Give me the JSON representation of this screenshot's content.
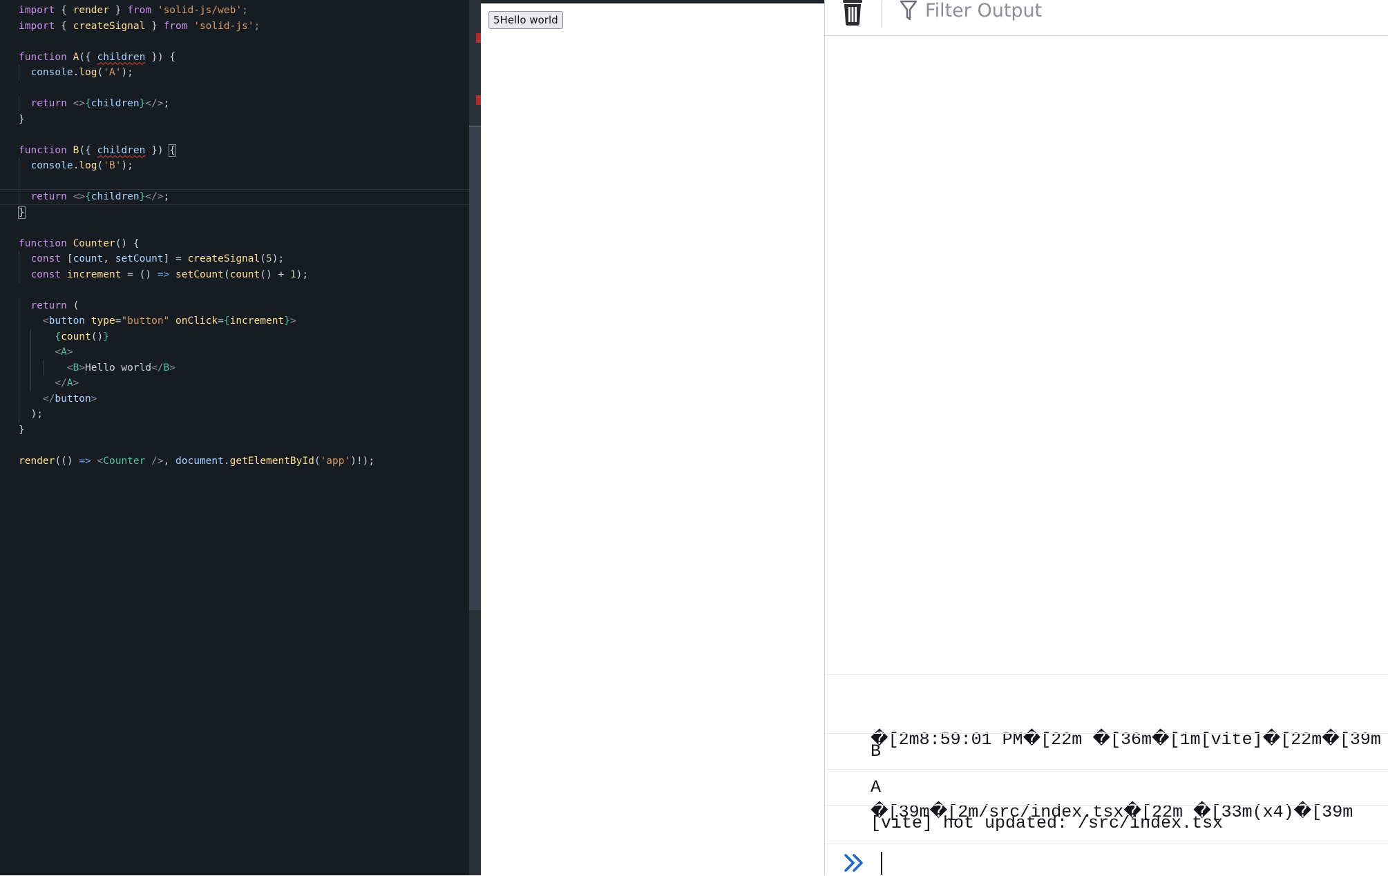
{
  "editor": {
    "lines": [
      [
        [
          "kw",
          "import"
        ],
        [
          "pl",
          " { "
        ],
        [
          "fn",
          "render"
        ],
        [
          "pl",
          " } "
        ],
        [
          "kw",
          "from"
        ],
        [
          "pl",
          " "
        ],
        [
          "st",
          "'solid-js/web'"
        ],
        [
          "pu",
          ";"
        ]
      ],
      [
        [
          "kw",
          "import"
        ],
        [
          "pl",
          " { "
        ],
        [
          "fn",
          "createSignal"
        ],
        [
          "pl",
          " } "
        ],
        [
          "kw",
          "from"
        ],
        [
          "pl",
          " "
        ],
        [
          "st",
          "'solid-js'"
        ],
        [
          "pu",
          ";"
        ]
      ],
      [],
      [
        [
          "kw",
          "function"
        ],
        [
          "pl",
          " "
        ],
        [
          "fn",
          "A"
        ],
        [
          "pl",
          "({ "
        ],
        [
          "vsq",
          "children"
        ],
        [
          "pl",
          " }) {"
        ]
      ],
      [
        [
          "pl",
          "  "
        ],
        [
          "var",
          "console"
        ],
        [
          "pl",
          "."
        ],
        [
          "fn",
          "log"
        ],
        [
          "pl",
          "("
        ],
        [
          "st",
          "'A'"
        ],
        [
          "pl",
          ");"
        ]
      ],
      [],
      [
        [
          "pl",
          "  "
        ],
        [
          "kw",
          "return"
        ],
        [
          "pl",
          " "
        ],
        [
          "pu",
          "<>"
        ],
        [
          "tag",
          "{"
        ],
        [
          "var",
          "children"
        ],
        [
          "tag",
          "}"
        ],
        [
          "pu",
          "</>"
        ],
        [
          "pl",
          ";"
        ]
      ],
      [
        [
          "pl",
          "}"
        ]
      ],
      [],
      [
        [
          "kw",
          "function"
        ],
        [
          "pl",
          " "
        ],
        [
          "fn",
          "B"
        ],
        [
          "pl",
          "({ "
        ],
        [
          "vsq",
          "children"
        ],
        [
          "pl",
          " }) "
        ],
        [
          "box",
          "{"
        ]
      ],
      [
        [
          "pl",
          "  "
        ],
        [
          "var",
          "console"
        ],
        [
          "pl",
          "."
        ],
        [
          "fn",
          "log"
        ],
        [
          "pl",
          "("
        ],
        [
          "st",
          "'B'"
        ],
        [
          "pl",
          ");"
        ]
      ],
      [],
      [
        [
          "pl",
          "  "
        ],
        [
          "kw",
          "return"
        ],
        [
          "pl",
          " "
        ],
        [
          "pu",
          "<>"
        ],
        [
          "tag",
          "{"
        ],
        [
          "var",
          "children"
        ],
        [
          "tag",
          "}"
        ],
        [
          "pu",
          "</>"
        ],
        [
          "pl",
          ";"
        ]
      ],
      [
        [
          "box",
          "}"
        ]
      ],
      [],
      [
        [
          "kw",
          "function"
        ],
        [
          "pl",
          " "
        ],
        [
          "fn",
          "Counter"
        ],
        [
          "pl",
          "() {"
        ]
      ],
      [
        [
          "pl",
          "  "
        ],
        [
          "kw",
          "const"
        ],
        [
          "pl",
          " ["
        ],
        [
          "var",
          "count"
        ],
        [
          "pl",
          ", "
        ],
        [
          "var",
          "setCount"
        ],
        [
          "pl",
          "] = "
        ],
        [
          "fn",
          "createSignal"
        ],
        [
          "pl",
          "("
        ],
        [
          "num",
          "5"
        ],
        [
          "pl",
          ");"
        ]
      ],
      [
        [
          "pl",
          "  "
        ],
        [
          "kw",
          "const"
        ],
        [
          "pl",
          " "
        ],
        [
          "fn",
          "increment"
        ],
        [
          "pl",
          " = () "
        ],
        [
          "op",
          "=>"
        ],
        [
          "pl",
          " "
        ],
        [
          "fn",
          "setCount"
        ],
        [
          "pl",
          "("
        ],
        [
          "fn",
          "count"
        ],
        [
          "pl",
          "() + "
        ],
        [
          "num",
          "1"
        ],
        [
          "pl",
          ");"
        ]
      ],
      [],
      [
        [
          "pl",
          "  "
        ],
        [
          "kw",
          "return"
        ],
        [
          "pl",
          " ("
        ]
      ],
      [
        [
          "pl",
          "    "
        ],
        [
          "pu",
          "<"
        ],
        [
          "var",
          "button"
        ],
        [
          "pl",
          " "
        ],
        [
          "fn",
          "type"
        ],
        [
          "pl",
          "="
        ],
        [
          "st",
          "\"button\""
        ],
        [
          "pl",
          " "
        ],
        [
          "fn",
          "onClick"
        ],
        [
          "pl",
          "="
        ],
        [
          "tag",
          "{"
        ],
        [
          "fn",
          "increment"
        ],
        [
          "tag",
          "}"
        ],
        [
          "pu",
          ">"
        ]
      ],
      [
        [
          "pl",
          "      "
        ],
        [
          "tag",
          "{"
        ],
        [
          "fn",
          "count"
        ],
        [
          "pl",
          "()"
        ],
        [
          "tag",
          "}"
        ]
      ],
      [
        [
          "pl",
          "      "
        ],
        [
          "pu",
          "<"
        ],
        [
          "tag",
          "A"
        ],
        [
          "pu",
          ">"
        ]
      ],
      [
        [
          "pl",
          "        "
        ],
        [
          "pu",
          "<"
        ],
        [
          "tag",
          "B"
        ],
        [
          "pu",
          ">"
        ],
        [
          "pl",
          "Hello world"
        ],
        [
          "pu",
          "</"
        ],
        [
          "tag",
          "B"
        ],
        [
          "pu",
          ">"
        ]
      ],
      [
        [
          "pl",
          "      "
        ],
        [
          "pu",
          "</"
        ],
        [
          "tag",
          "A"
        ],
        [
          "pu",
          ">"
        ]
      ],
      [
        [
          "pl",
          "    "
        ],
        [
          "pu",
          "</"
        ],
        [
          "var",
          "button"
        ],
        [
          "pu",
          ">"
        ]
      ],
      [
        [
          "pl",
          "  );"
        ]
      ],
      [
        [
          "pl",
          "}"
        ]
      ],
      [],
      [
        [
          "fn",
          "render"
        ],
        [
          "pl",
          "(() "
        ],
        [
          "op",
          "=>"
        ],
        [
          "pl",
          " "
        ],
        [
          "pu",
          "<"
        ],
        [
          "tag",
          "Counter"
        ],
        [
          "pl",
          " "
        ],
        [
          "pu",
          "/>"
        ],
        [
          "pl",
          ", "
        ],
        [
          "var",
          "document"
        ],
        [
          "pl",
          "."
        ],
        [
          "fn",
          "getElementById"
        ],
        [
          "pl",
          "("
        ],
        [
          "st",
          "'app'"
        ],
        [
          "pl",
          ")!);"
        ]
      ]
    ]
  },
  "preview": {
    "button_label": "5Hello world"
  },
  "console": {
    "trash_icon": "trash-icon",
    "filter_icon": "filter-icon",
    "filter_placeholder": "Filter Output",
    "messages": [
      {
        "line1": "�[2m8:59:01 PM�[22m �[36m�[1m[vite]�[22m�[39m",
        "line2": "�[39m�[2m/src/index.tsx�[22m �[33m(x4)�[39m"
      },
      {
        "text": "B"
      },
      {
        "text": "A"
      },
      {
        "text": "[vite] hot updated: /src/index.tsx"
      }
    ],
    "prompt_icon": "double-chevron-right-icon",
    "colors": {
      "accent": "#1a67d3"
    }
  },
  "colors": {
    "editor_bg": "#171b22",
    "keyword": "#c792ea",
    "function": "#ffdf8f",
    "string": "#d79a62",
    "variable": "#a5d4ff",
    "tag": "#4fc1a3"
  }
}
